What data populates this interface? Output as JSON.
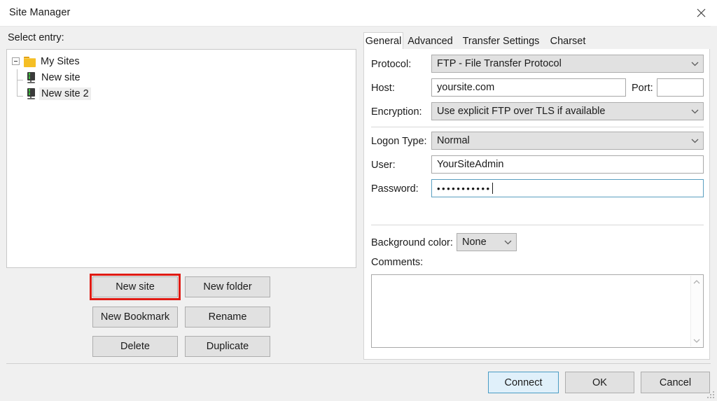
{
  "window": {
    "title": "Site Manager",
    "close_icon": "close-icon"
  },
  "left_panel": {
    "select_entry_label": "Select entry:",
    "tree": {
      "root": {
        "label": "My Sites",
        "icon": "folder-icon",
        "expanded": true,
        "expander_glyph": "minus"
      },
      "children": [
        {
          "label": "New site",
          "icon": "server-icon",
          "selected": false
        },
        {
          "label": "New site 2",
          "icon": "server-icon",
          "selected": true
        }
      ]
    },
    "buttons": {
      "new_site": "New site",
      "new_folder": "New folder",
      "new_bookmark": "New Bookmark",
      "rename": "Rename",
      "delete": "Delete",
      "duplicate": "Duplicate"
    },
    "highlight": {
      "target": "new_site",
      "color": "#e01b14"
    }
  },
  "right_panel": {
    "tabs": [
      {
        "label": "General",
        "active": true
      },
      {
        "label": "Advanced",
        "active": false
      },
      {
        "label": "Transfer Settings",
        "active": false
      },
      {
        "label": "Charset",
        "active": false
      }
    ],
    "general": {
      "protocol": {
        "label": "Protocol:",
        "value": "FTP - File Transfer Protocol",
        "chevron_icon": "chevron-down-icon"
      },
      "host": {
        "label": "Host:",
        "value": "yoursite.com"
      },
      "port": {
        "label": "Port:",
        "value": ""
      },
      "encryption": {
        "label": "Encryption:",
        "value": "Use explicit FTP over TLS if available",
        "chevron_icon": "chevron-down-icon"
      },
      "logon_type": {
        "label": "Logon Type:",
        "value": "Normal",
        "chevron_icon": "chevron-down-icon"
      },
      "user": {
        "label": "User:",
        "value": "YourSiteAdmin"
      },
      "password": {
        "label": "Password:",
        "value": "•••••••••••",
        "focused": true
      },
      "background_color": {
        "label": "Background color:",
        "value": "None",
        "chevron_icon": "chevron-down-icon"
      },
      "comments": {
        "label": "Comments:",
        "value": "",
        "scroll_up_icon": "chevron-up-icon",
        "scroll_down_icon": "chevron-down-icon"
      }
    }
  },
  "footer": {
    "connect": "Connect",
    "ok": "OK",
    "cancel": "Cancel",
    "default_button": "connect",
    "resize_grip_icon": "resize-grip-icon"
  }
}
